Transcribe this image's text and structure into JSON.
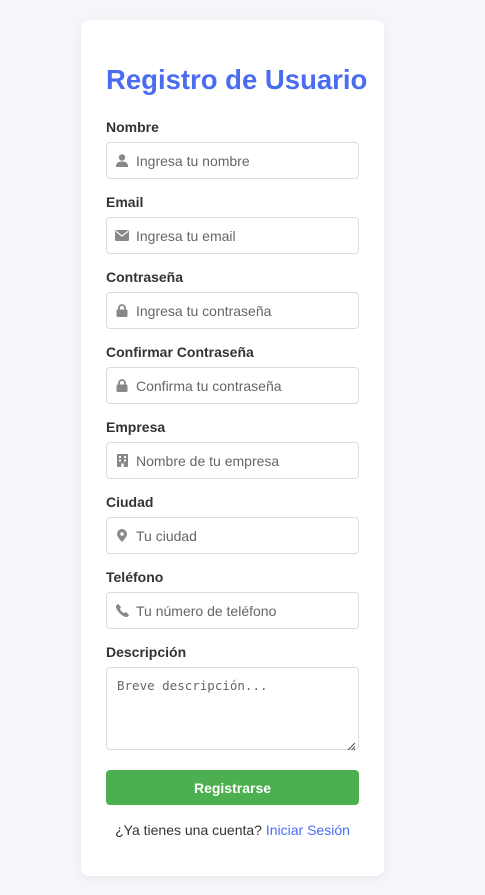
{
  "form": {
    "title": "Registro de Usuario",
    "fields": [
      {
        "label": "Nombre",
        "placeholder": "Ingresa tu nombre",
        "icon": "user-icon"
      },
      {
        "label": "Email",
        "placeholder": "Ingresa tu email",
        "icon": "envelope-icon"
      },
      {
        "label": "Contraseña",
        "placeholder": "Ingresa tu contraseña",
        "icon": "lock-icon"
      },
      {
        "label": "Confirmar Contraseña",
        "placeholder": "Confirma tu contraseña",
        "icon": "lock-icon"
      },
      {
        "label": "Empresa",
        "placeholder": "Nombre de tu empresa",
        "icon": "building-icon"
      },
      {
        "label": "Ciudad",
        "placeholder": "Tu ciudad",
        "icon": "map-marker-icon"
      },
      {
        "label": "Teléfono",
        "placeholder": "Tu número de teléfono",
        "icon": "phone-icon"
      }
    ],
    "description": {
      "label": "Descripción",
      "placeholder": "Breve descripción..."
    },
    "submit_label": "Registrarse",
    "footer": {
      "prompt": "¿Ya tienes una cuenta?",
      "login_link": "Iniciar Sesión"
    }
  },
  "colors": {
    "title": "#4a6cf0",
    "submit_bg": "#4caf50",
    "link": "#4a6cf0",
    "icon": "#888888",
    "page_bg": "#f5f6fa"
  }
}
